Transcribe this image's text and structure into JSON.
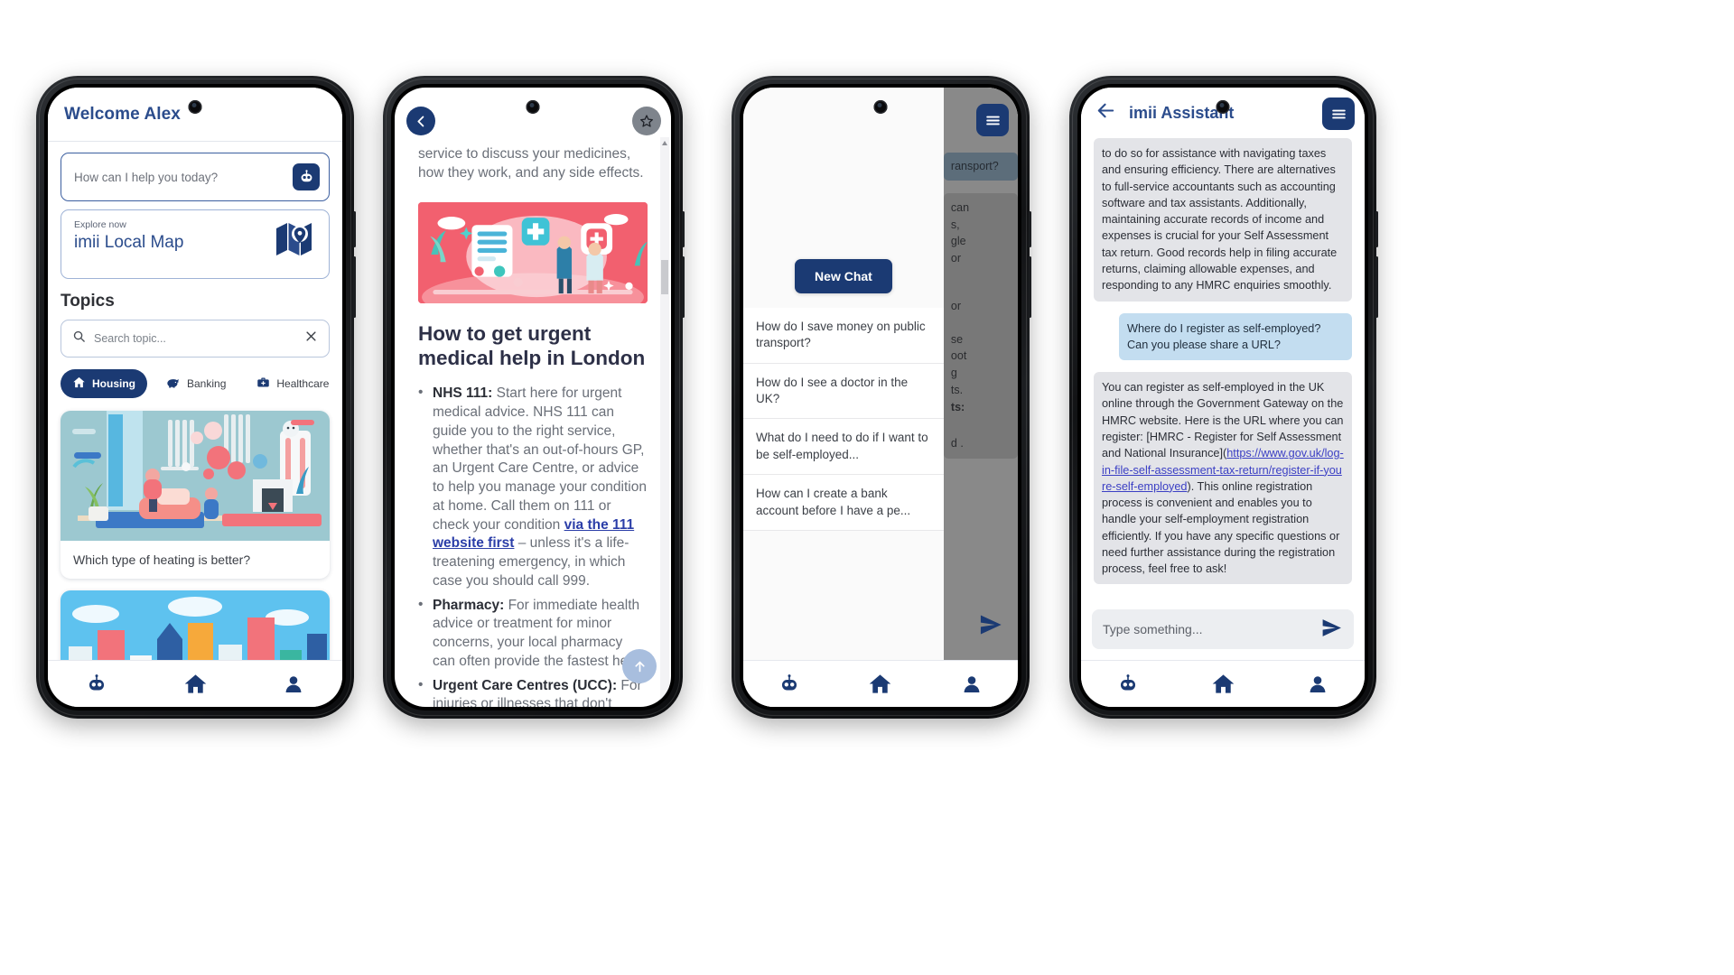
{
  "phone1": {
    "header_title": "Welcome Alex",
    "ask_placeholder": "How can I help you today?",
    "bot_icon": "robot-icon",
    "explore_label": "Explore now",
    "explore_name": "imii Local Map",
    "map_icon": "map-icon",
    "topics_heading": "Topics",
    "search_placeholder": "Search topic...",
    "search_icon": "search-icon",
    "clear_icon": "close-icon",
    "chips": [
      {
        "label": "Housing",
        "icon": "home-icon",
        "active": true
      },
      {
        "label": "Banking",
        "icon": "piggy-bank-icon",
        "active": false
      },
      {
        "label": "Healthcare",
        "icon": "medical-bag-icon",
        "active": false
      }
    ],
    "cards": [
      {
        "caption": "Which type of heating is better?"
      },
      {
        "caption": ""
      }
    ],
    "tabs": [
      {
        "name": "assistant",
        "icon": "robot-icon",
        "active": false
      },
      {
        "name": "home",
        "icon": "home-icon",
        "active": true
      },
      {
        "name": "profile",
        "icon": "person-icon",
        "active": false
      }
    ]
  },
  "phone2": {
    "back_icon": "chevron-left-icon",
    "star_icon": "star-icon",
    "lead_text": "service to discuss your medicines, how they work, and any side effects.",
    "hero_alt": "urgent-medical-help-illustration",
    "article_title": "How to get urgent medical help in London",
    "bullets": [
      {
        "term": "NHS 111:",
        "before": " Start here for urgent medical advice. NHS 111 can guide you to the right service, whether that's an out-of-hours GP, an Urgent Care Centre, or advice to help you manage your condition at home. Call them on 111 or check your condition ",
        "link": "via the 111 website first",
        "after": " – unless it's a life-treatening emergency, in which case you should call 999."
      },
      {
        "term": "Pharmacy:",
        "before": " For immediate health advice or treatment for minor concerns, your local pharmacy can often provide the fastest help.",
        "link": "",
        "after": ""
      },
      {
        "term": "Urgent Care Centres (UCC):",
        "before": " For injuries or illnesses that don't",
        "link": "",
        "after": ""
      }
    ],
    "scroll_up_icon": "arrow-up-icon"
  },
  "phone3": {
    "hamburger_icon": "hamburger-menu-icon",
    "new_chat_label": "New Chat",
    "conversations": [
      "How do I save money on public transport?",
      "How do I see a doctor in the UK?",
      "What do I need to do if I want to be self-employed...",
      "How can I create a bank account before I have a pe..."
    ],
    "background_user_bubble": "ransport?",
    "background_fragments": [
      "can",
      "s,",
      "gle",
      "or",
      "or",
      "se",
      "oot",
      "g",
      "ts.",
      "ts:",
      "d ."
    ],
    "send_icon": "send-icon",
    "tabs": [
      {
        "name": "assistant",
        "icon": "robot-icon",
        "active": true
      },
      {
        "name": "home",
        "icon": "home-icon",
        "active": false
      },
      {
        "name": "profile",
        "icon": "person-icon",
        "active": false
      }
    ]
  },
  "phone4": {
    "back_icon": "arrow-left-icon",
    "title": "imii Assistant",
    "hamburger_icon": "hamburger-menu-icon",
    "messages": [
      {
        "role": "assistant",
        "text": "to do so for assistance with navigating taxes and ensuring efficiency. There are alternatives to full-service accountants such as accounting software and tax assistants. Additionally, maintaining accurate records of income and expenses is crucial for your Self Assessment tax return. Good records help in filing accurate returns, claiming allowable expenses, and responding to any HMRC enquiries smoothly."
      },
      {
        "role": "user",
        "text": "Where do I register as self-employed? Can you please share a URL?"
      },
      {
        "role": "assistant",
        "text_before": "You can register as self-employed in the UK online through the Government Gateway on the HMRC website. Here is the URL where you can register: [HMRC - Register for Self Assessment and National Insurance](",
        "link": "https://www.gov.uk/log-in-file-self-assessment-tax-return/register-if-youre-self-employed",
        "text_after": "). This online registration process is convenient and enables you to handle your self-employment registration efficiently. If you have any specific questions or need further assistance during the registration process, feel free to ask!"
      }
    ],
    "input_placeholder": "Type something...",
    "send_icon": "send-icon",
    "tabs": [
      {
        "name": "assistant",
        "icon": "robot-icon",
        "active": true
      },
      {
        "name": "home",
        "icon": "home-icon",
        "active": false
      },
      {
        "name": "profile",
        "icon": "person-icon",
        "active": false
      }
    ]
  },
  "colors": {
    "brand_navy": "#1b3a73",
    "brand_blue_text": "#2b4c8c",
    "user_bubble": "#c3ddf0",
    "assistant_bubble": "#e3e4e8",
    "link": "#3b3fc4",
    "hero_pink": "#f4607a"
  }
}
